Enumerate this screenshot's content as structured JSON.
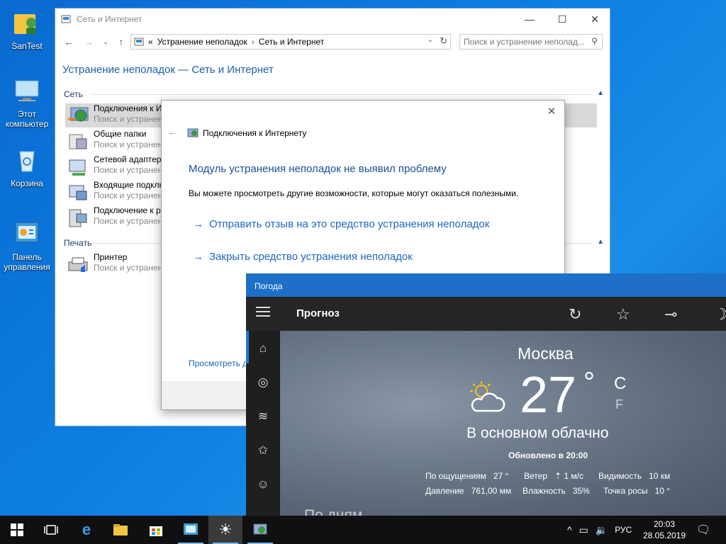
{
  "desktop": {
    "icons": [
      {
        "label": "SanTest"
      },
      {
        "label": "Этот компьютер"
      },
      {
        "label": "Корзина"
      },
      {
        "label": "Панель управления"
      }
    ]
  },
  "control_panel": {
    "title": "Сеть и Интернет",
    "breadcrumb": {
      "chevron": "«",
      "part1": "Устранение неполадок",
      "sep": "›",
      "part2": "Сеть и Интернет"
    },
    "search_placeholder": "Поиск и устранение неполад...",
    "heading": "Устранение неполадок — Сеть и Интернет",
    "groups": [
      {
        "label": "Сеть",
        "items": [
          {
            "title": "Подключения к И",
            "sub": "Поиск и устранен"
          },
          {
            "title": "Общие папки",
            "sub": "Поиск и устранен"
          },
          {
            "title": "Сетевой адаптер",
            "sub": "Поиск и устранен"
          },
          {
            "title": "Входящие подклю",
            "sub": "Поиск и устранен"
          },
          {
            "title": "Подключение к р",
            "sub": "Поиск и устранен"
          }
        ]
      },
      {
        "label": "Печать",
        "items": [
          {
            "title": "Принтер",
            "sub": "Поиск и устранен"
          }
        ]
      }
    ]
  },
  "troubleshooter": {
    "header": "Подключения к Интернету",
    "result": "Модуль устранения неполадок не выявил проблему",
    "description": "Вы можете просмотреть другие возможности, которые могут оказаться полезными.",
    "links": [
      {
        "label": "Отправить отзыв на это средство устранения неполадок"
      },
      {
        "label": "Закрыть средство устранения неполадок"
      }
    ],
    "more_link": "Просмотреть д"
  },
  "weather": {
    "app_title": "Погода",
    "page_title": "Прогноз",
    "city": "Москва",
    "temperature": "27",
    "degree": "°",
    "unit_c": "C",
    "unit_f": "F",
    "condition": "В основном облачно",
    "updated": "Обновлено в 20:00",
    "details": [
      {
        "label": "По ощущениям",
        "value": "27 °"
      },
      {
        "label": "Ветер",
        "value": "1 м/с"
      },
      {
        "label": "Видимость",
        "value": "10 км"
      },
      {
        "label": "Давление",
        "value": "761,00 мм"
      },
      {
        "label": "Влажность",
        "value": "35%"
      },
      {
        "label": "Точка росы",
        "value": "10 °"
      }
    ],
    "days_heading": "По дням"
  },
  "taskbar": {
    "language": "РУС",
    "time": "20:03",
    "date": "28.05.2019"
  },
  "colors": {
    "accent": "#1e78d8",
    "link": "#1e67c0",
    "heading": "#1e5ea8",
    "weather_title": "#1d6fc8"
  }
}
